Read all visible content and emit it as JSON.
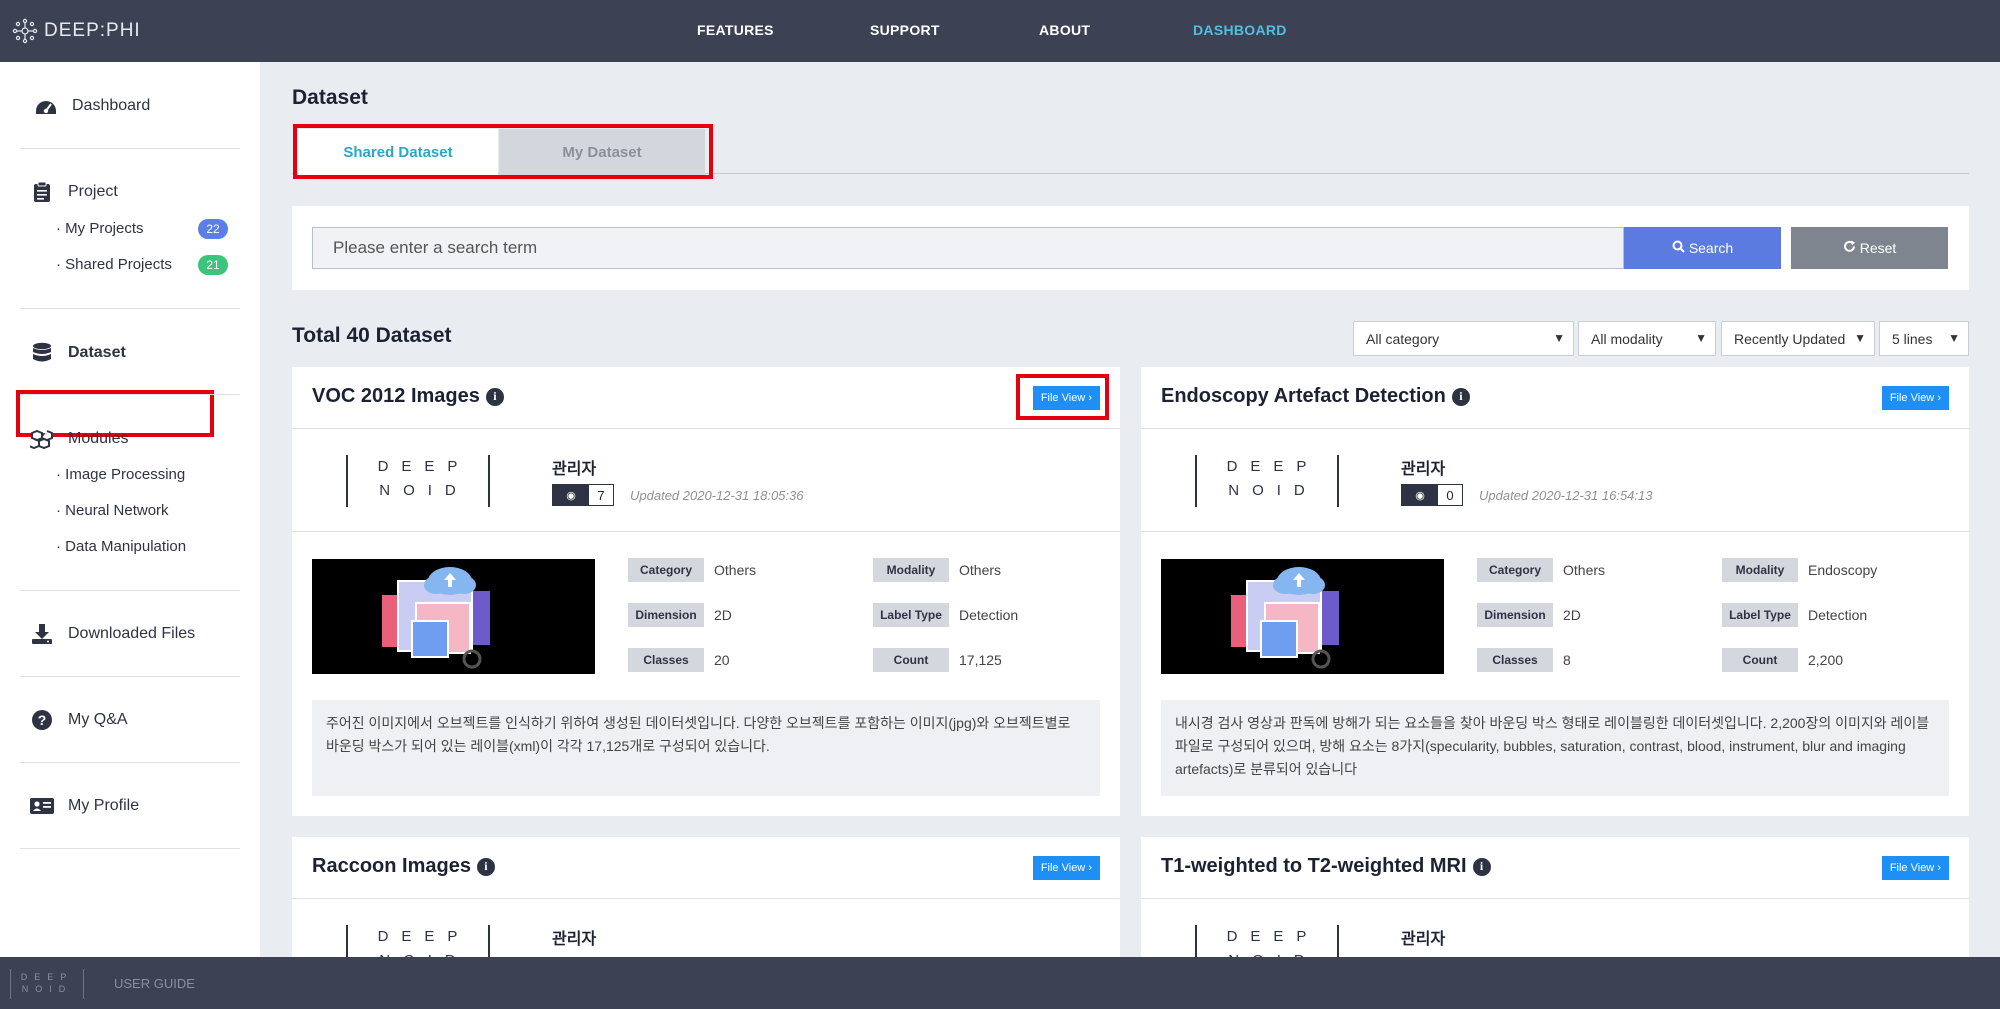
{
  "app": {
    "logo_text": "DEEP:PHI"
  },
  "nav": {
    "items": [
      "FEATURES",
      "SUPPORT",
      "ABOUT",
      "DASHBOARD"
    ],
    "active": "DASHBOARD"
  },
  "sidebar": {
    "dashboard": "Dashboard",
    "project": "Project",
    "my_projects": "My Projects",
    "my_projects_count": "22",
    "shared_projects": "Shared Projects",
    "shared_projects_count": "21",
    "dataset": "Dataset",
    "modules": "Modules",
    "image_processing": "Image Processing",
    "neural_network": "Neural Network",
    "data_manipulation": "Data Manipulation",
    "downloaded_files": "Downloaded Files",
    "my_qna": "My Q&A",
    "my_profile": "My Profile"
  },
  "footer": {
    "logo_text": "DEEP NOID",
    "user_guide": "USER GUIDE"
  },
  "main": {
    "title": "Dataset",
    "tabs": [
      "Shared Dataset",
      "My Dataset"
    ],
    "search_placeholder": "Please enter a search term",
    "search_label": "Search",
    "reset_label": "Reset",
    "total": "Total 40 Dataset",
    "filters": [
      "All category",
      "All modality",
      "Recently Updated",
      "5 lines"
    ]
  },
  "labels": {
    "file_view": "File View",
    "category": "Category",
    "modality": "Modality",
    "dimension": "Dimension",
    "label_type": "Label Type",
    "classes": "Classes",
    "count": "Count",
    "provider_logo": "DEEP NOID"
  },
  "cards": [
    {
      "title": "VOC 2012 Images",
      "owner": "관리자",
      "views": "7",
      "updated": "Updated 2020-12-31 18:05:36",
      "category": "Others",
      "modality": "Others",
      "dimension": "2D",
      "label_type": "Detection",
      "classes": "20",
      "count": "17,125",
      "description": "주어진 이미지에서 오브젝트를 인식하기 위하여 생성된 데이터셋입니다. 다양한 오브젝트를 포함하는 이미지(jpg)와 오브젝트별로 바운딩 박스가 되어 있는 레이블(xml)이 각각 17,125개로 구성되어 있습니다."
    },
    {
      "title": "Endoscopy Artefact Detection",
      "owner": "관리자",
      "views": "0",
      "updated": "Updated 2020-12-31 16:54:13",
      "category": "Others",
      "modality": "Endoscopy",
      "dimension": "2D",
      "label_type": "Detection",
      "classes": "8",
      "count": "2,200",
      "description": "내시경 검사 영상과 판독에 방해가 되는 요소들을 찾아 바운딩 박스 형태로 레이블링한 데이터셋입니다. 2,200장의 이미지와 레이블 파일로 구성되어 있으며, 방해 요소는 8가지(specularity, bubbles, saturation, contrast, blood, instrument, blur and imaging artefacts)로 분류되어 있습니다"
    },
    {
      "title": "Raccoon Images",
      "owner": "관리자"
    },
    {
      "title": "T1-weighted to T2-weighted MRI",
      "owner": "관리자"
    }
  ]
}
